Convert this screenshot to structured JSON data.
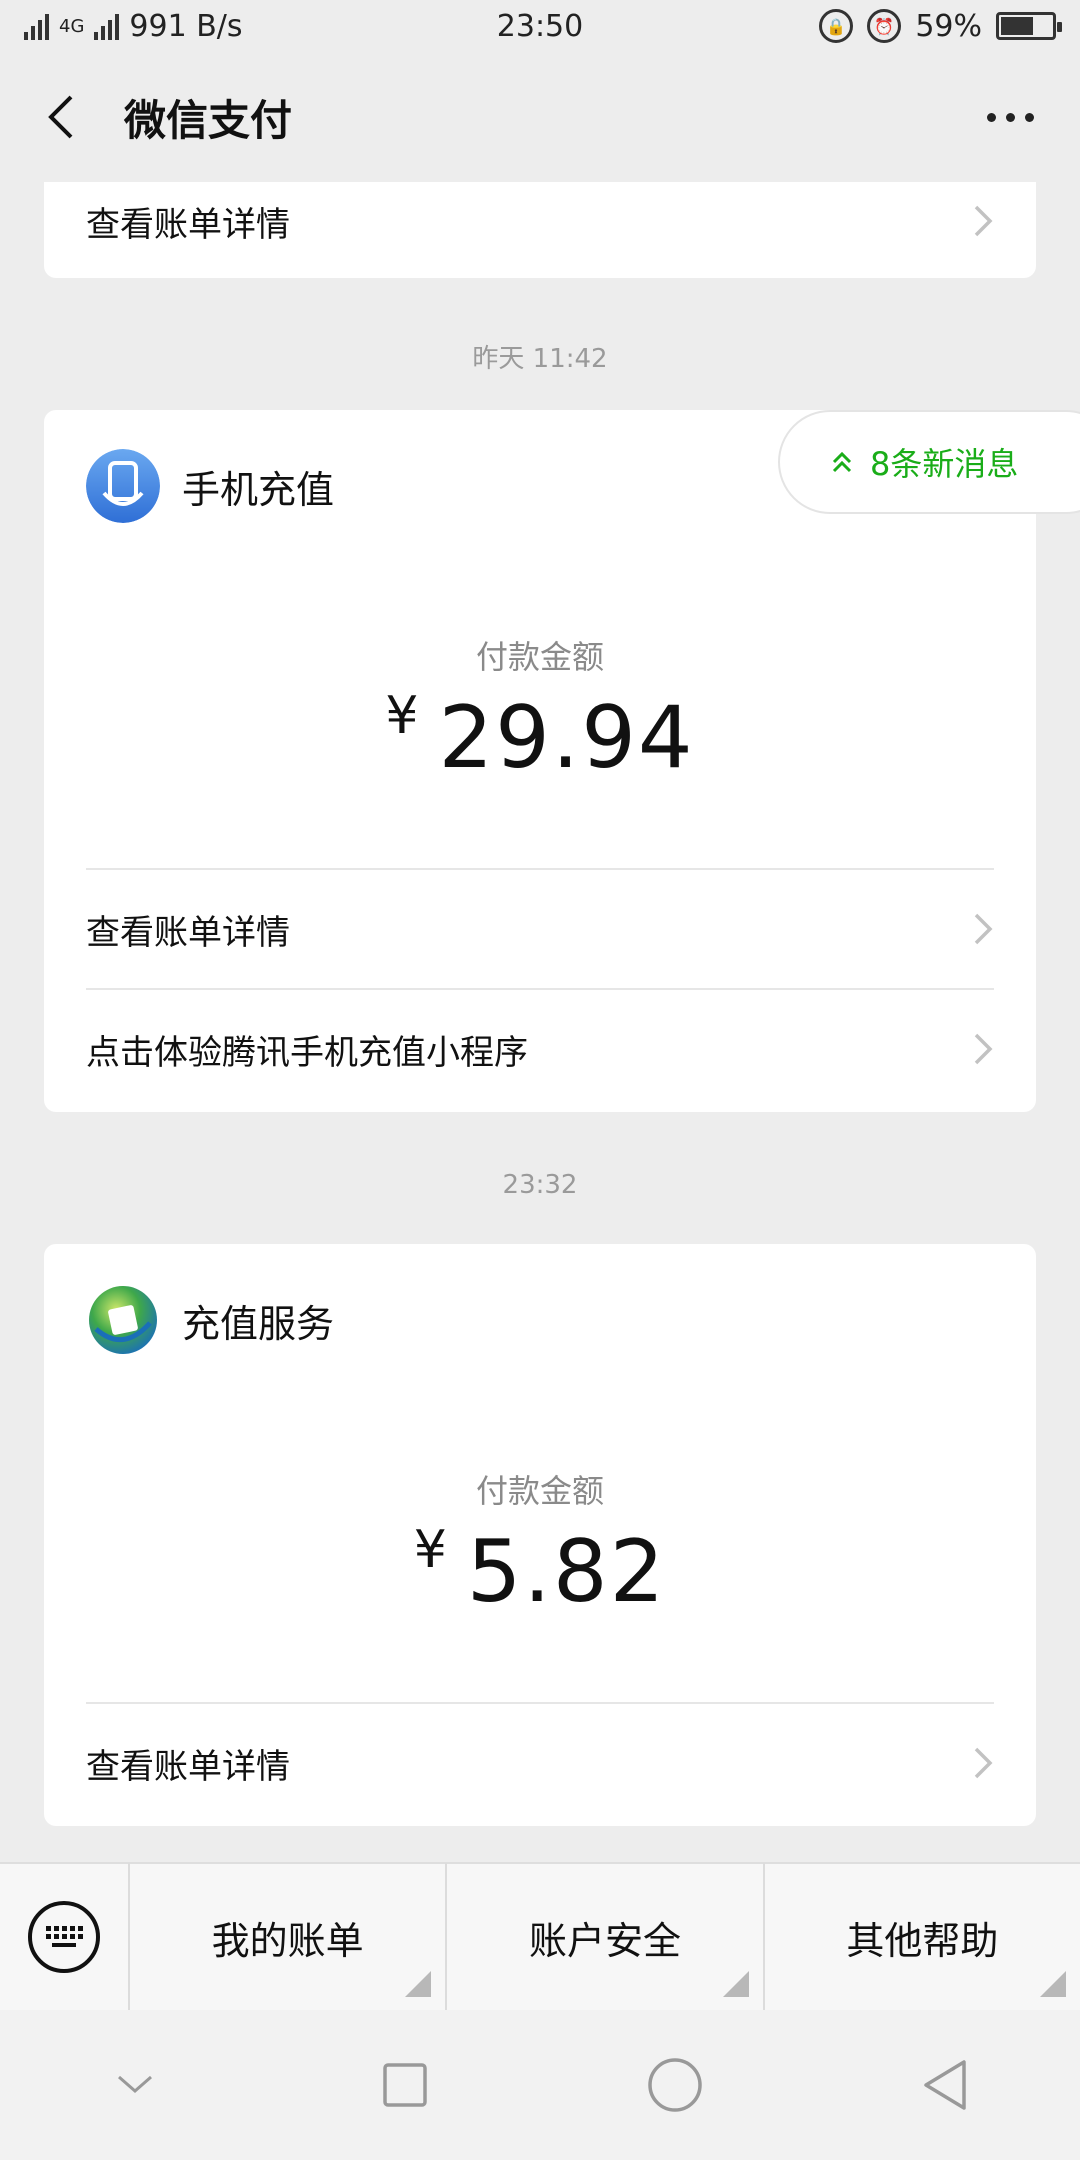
{
  "status_bar": {
    "network": "4G",
    "speed": "991 B/s",
    "time": "23:50",
    "battery": "59%",
    "battery_level": 0.59
  },
  "header": {
    "title": "微信支付"
  },
  "top_card": {
    "link": "查看账单详情"
  },
  "new_messages": "8条新消息",
  "cards": [
    {
      "timestamp": "昨天 11:42",
      "icon": "phone-recharge-icon",
      "app_name": "手机充值",
      "amount_label": "付款金额",
      "currency": "¥",
      "amount": "29.94",
      "links": [
        "查看账单详情",
        "点击体验腾讯手机充值小程序"
      ]
    },
    {
      "timestamp": "23:32",
      "icon": "recharge-service-icon",
      "app_name": "充值服务",
      "amount_label": "付款金额",
      "currency": "¥",
      "amount": "5.82",
      "links": [
        "查看账单详情"
      ]
    }
  ],
  "bottom_menu": {
    "items": [
      "我的账单",
      "账户安全",
      "其他帮助"
    ]
  },
  "colors": {
    "accent_green": "#1aad19",
    "background": "#ededed"
  }
}
